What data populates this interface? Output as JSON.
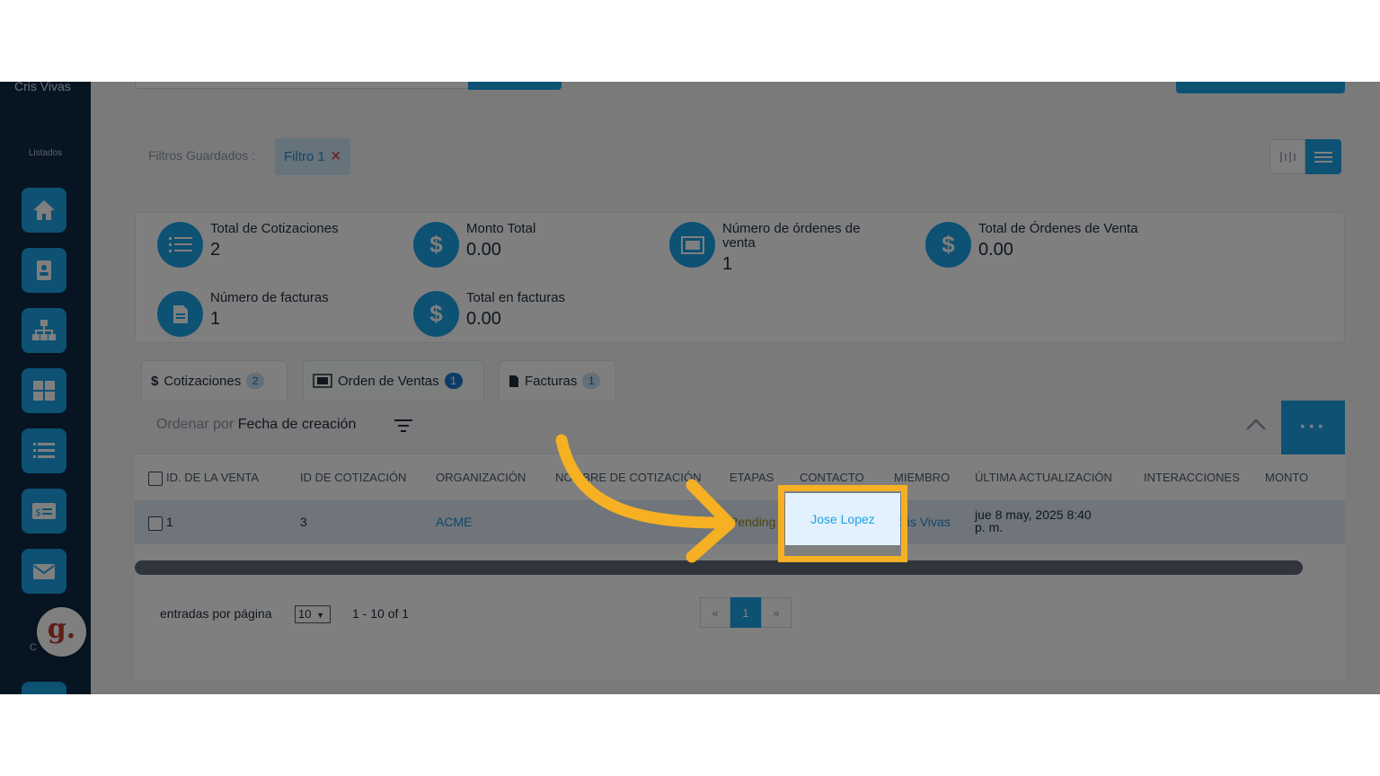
{
  "sidebar": {
    "user_name": "Cris Vivas",
    "section_label": "Listados",
    "items": [
      {
        "icon": "home-icon"
      },
      {
        "icon": "contact-card-icon"
      },
      {
        "icon": "org-chart-icon"
      },
      {
        "icon": "grid-icon"
      },
      {
        "icon": "list-icon"
      },
      {
        "icon": "invoice-icon"
      },
      {
        "icon": "mail-icon"
      }
    ],
    "help_badge": "g.",
    "truncated_label": "C"
  },
  "filters": {
    "label": "Filtros Guardados :",
    "chip_label": "Filtro 1",
    "chip_close": "×"
  },
  "stats": [
    {
      "label": "Total de Cotizaciones",
      "value": "2",
      "icon": "list-icon"
    },
    {
      "label": "Monto Total",
      "value": "0.00",
      "icon": "dollar-icon"
    },
    {
      "label": "Número de órdenes de venta",
      "value": "1",
      "icon": "sales-order-icon"
    },
    {
      "label": "Total de Órdenes de Venta",
      "value": "0.00",
      "icon": "dollar-icon"
    },
    {
      "label": "Número de facturas",
      "value": "1",
      "icon": "invoice-icon"
    },
    {
      "label": "Total en facturas",
      "value": "0.00",
      "icon": "dollar-icon"
    }
  ],
  "tabs": [
    {
      "label": "Cotizaciones",
      "count": "2"
    },
    {
      "label": "Orden de Ventas",
      "count": "1"
    },
    {
      "label": "Facturas",
      "count": "1"
    }
  ],
  "sort": {
    "prefix": "Ordenar por",
    "field": "Fecha de creación"
  },
  "more_label": "···",
  "table": {
    "headers": [
      "ID. DE LA VENTA",
      "ID DE COTIZACIÓN",
      "ORGANIZACIÓN",
      "NOMBRE DE COTIZACIÓN",
      "ETAPAS",
      "CONTACTO",
      "MIEMBRO",
      "ÚLTIMA ACTUALIZACIÓN",
      "INTERACCIONES",
      "MONTO"
    ],
    "rows": [
      {
        "id": "1",
        "quote_id": "3",
        "organization": "ACME",
        "quote_name": "",
        "stage": "Pending",
        "contact": "Jose Lopez",
        "member": "Cris Vivas",
        "updated_line1": "jue 8 may, 2025 8:40",
        "updated_line2": "p. m."
      }
    ]
  },
  "pagination": {
    "per_page_label": "entradas por página",
    "per_page_value": "10",
    "range": "1 - 10 of 1",
    "prev": "«",
    "current": "1",
    "next": "»"
  },
  "colors": {
    "accent": "#1aa3e6",
    "sidebar": "#0e2a44",
    "highlight": "#f5b024"
  }
}
